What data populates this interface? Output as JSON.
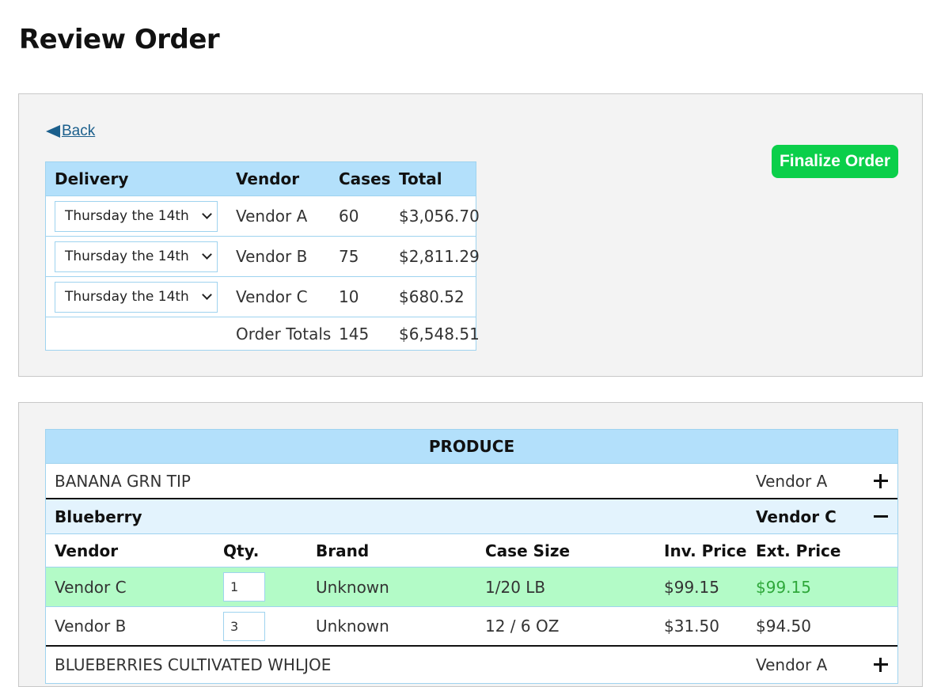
{
  "page": {
    "title": "Review Order"
  },
  "nav": {
    "back_label": "Back"
  },
  "actions": {
    "finalize_label": "Finalize Order",
    "finalize_color": "#0bcf4a"
  },
  "summary": {
    "headers": {
      "delivery": "Delivery",
      "vendor": "Vendor",
      "cases": "Cases",
      "total": "Total"
    },
    "rows": [
      {
        "delivery": "Thursday the 14th",
        "vendor": "Vendor A",
        "cases": "60",
        "total": "$3,056.70"
      },
      {
        "delivery": "Thursday the 14th",
        "vendor": "Vendor B",
        "cases": "75",
        "total": "$2,811.29"
      },
      {
        "delivery": "Thursday the 14th",
        "vendor": "Vendor C",
        "cases": "10",
        "total": "$680.52"
      }
    ],
    "totals": {
      "label": "Order Totals",
      "cases": "145",
      "total": "$6,548.51"
    }
  },
  "products": {
    "category": "PRODUCE",
    "items": [
      {
        "name": "BANANA GRN TIP",
        "vendor": "Vendor A"
      },
      {
        "name": "Blueberry",
        "vendor": "Vendor C"
      },
      {
        "name": "BLUEBERRIES CULTIVATED WHLJOE",
        "vendor": "Vendor A"
      }
    ],
    "detail_headers": {
      "vendor": "Vendor",
      "qty": "Qty.",
      "brand": "Brand",
      "case_size": "Case Size",
      "inv_price": "Inv. Price",
      "ext_price": "Ext. Price"
    },
    "detail_rows": [
      {
        "vendor": "Vendor C",
        "qty": "1",
        "brand": "Unknown",
        "case_size": "1/20 LB",
        "inv_price": "$99.15",
        "ext_price": "$99.15"
      },
      {
        "vendor": "Vendor B",
        "qty": "3",
        "brand": "Unknown",
        "case_size": "12 / 6 OZ",
        "inv_price": "$31.50",
        "ext_price": "$94.50"
      }
    ]
  },
  "colors": {
    "header_blue": "#b3e0fb",
    "expanded_blue": "#e3f3fd",
    "selected_green": "#b3fbc7",
    "link_blue": "#1b5f8c"
  }
}
